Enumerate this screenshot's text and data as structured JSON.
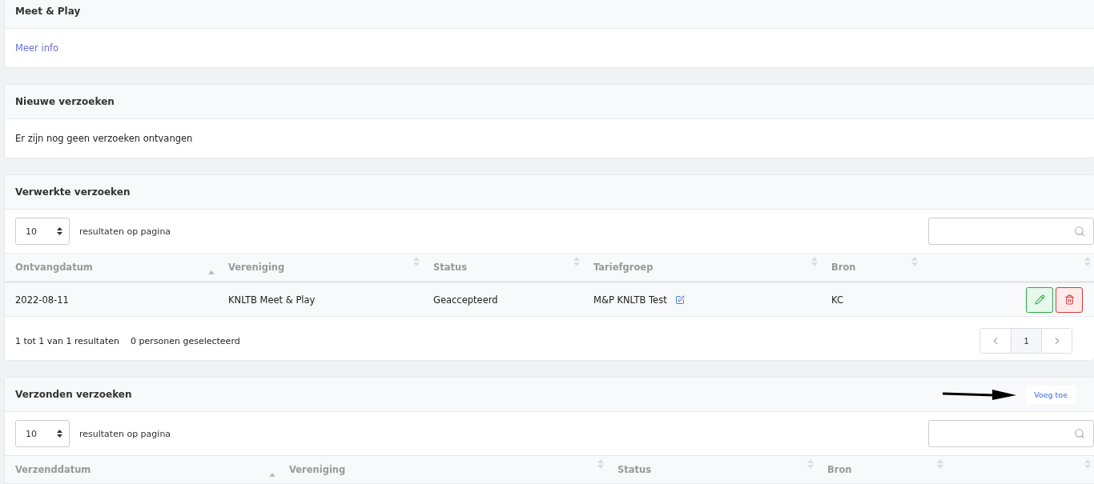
{
  "cards": [
    {
      "title": "Meet & Play",
      "kind": "link",
      "link": "Meer info"
    },
    {
      "title": "Nieuwe verzoeken",
      "kind": "text",
      "text": "Er zijn nog geen verzoeken ontvangen"
    },
    {
      "title": "Verwerkte verzoeken",
      "kind": "table",
      "page_size": "10",
      "page_size_label": "resultaten op pagina",
      "columns": [
        {
          "label": "Ontvangdatum",
          "sorted": true
        },
        {
          "label": "Vereniging",
          "sorted": false
        },
        {
          "label": "Status",
          "sorted": false
        },
        {
          "label": "Tariefgroep",
          "sorted": false
        },
        {
          "label": "Bron",
          "sorted": false
        },
        {
          "sorted": false
        }
      ],
      "rows": [
        {
          "cells": [
            "2022-08-11",
            "KNLTB Meet & Play",
            "Geaccepteerd",
            "M&P KNLTB Test",
            "KC"
          ]
        }
      ],
      "summary": "1 tot 1 van 1 resultaten",
      "selected_count": "0 personen geselecteerd",
      "pages": [
        {
          "label": "1",
          "selected": true
        }
      ]
    },
    {
      "title": "Verzonden verzoeken",
      "kind": "table",
      "action": "Voeg toe",
      "page_size": "10",
      "page_size_label": "resultaten op pagina",
      "columns": [
        {
          "label": "Verzenddatum",
          "sorted": true
        },
        {
          "label": "Vereniging",
          "sorted": false
        },
        {
          "label": "Status",
          "sorted": false
        },
        {
          "label": "Bron",
          "sorted": false
        },
        {
          "sorted": false
        }
      ]
    }
  ]
}
